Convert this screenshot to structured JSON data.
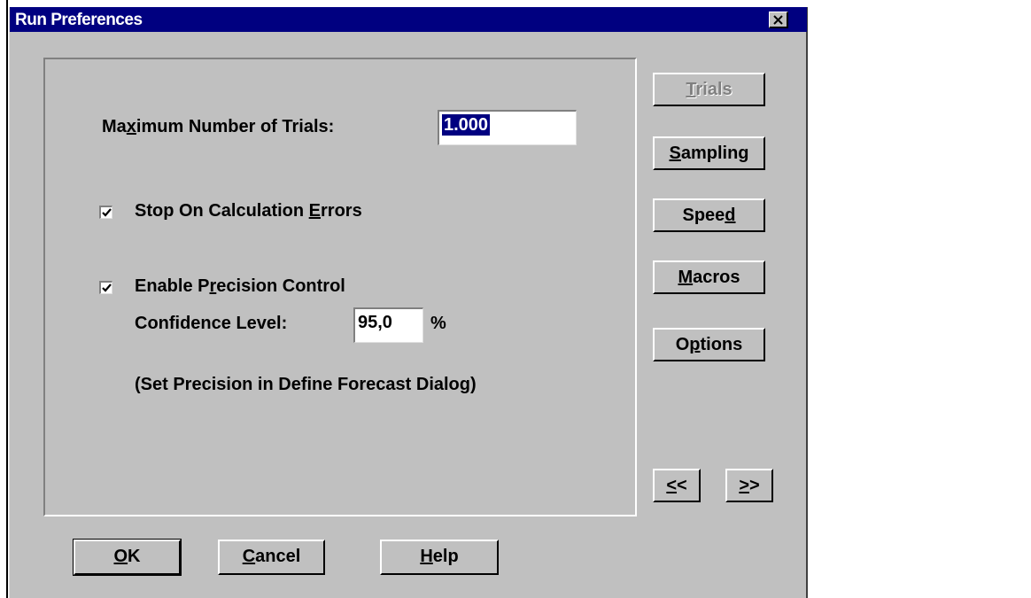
{
  "window": {
    "title": "Run Preferences"
  },
  "form": {
    "max_trials_label": "Maximum Number of Trials:",
    "max_trials_value": "1.000",
    "stop_on_errors_label": "Stop On Calculation Errors",
    "stop_on_errors_checked": true,
    "precision_label": "Enable Precision Control",
    "precision_checked": true,
    "confidence_label": "Confidence Level:",
    "confidence_value": "95,0",
    "confidence_unit": "%",
    "precision_note": "(Set Precision in Define Forecast Dialog)"
  },
  "side_buttons": {
    "trials": "Trials",
    "sampling": "Sampling",
    "speed": "Speed",
    "macros": "Macros",
    "options": "Options",
    "prev": "<<",
    "next": ">>"
  },
  "footer": {
    "ok": "OK",
    "cancel": "Cancel",
    "help": "Help"
  },
  "colors": {
    "title_bar": "#000080",
    "dialog_face": "#c0c0c0",
    "selection": "#000080"
  },
  "icons": {
    "close": "close-icon",
    "check": "checkmark-icon"
  }
}
